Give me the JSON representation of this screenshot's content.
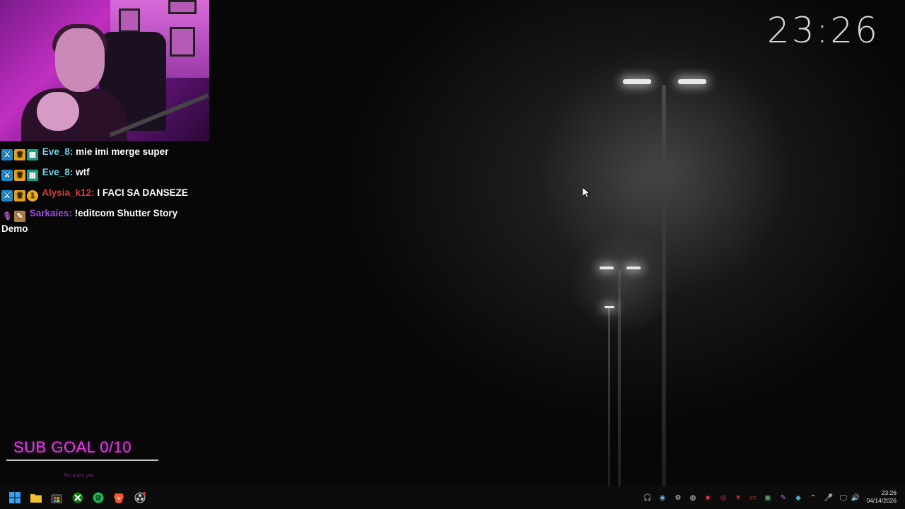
{
  "clock": "23:26",
  "chat": {
    "messages": [
      {
        "user": "Eve_8",
        "user_color": "#70d6e8",
        "badges": [
          "mod",
          "crown",
          "sub"
        ],
        "text": "mie imi merge super"
      },
      {
        "user": "Eve_8",
        "user_color": "#70d6e8",
        "badges": [
          "mod",
          "crown",
          "sub"
        ],
        "text": "wtf"
      },
      {
        "user": "Alysia_k12",
        "user_color": "#e03838",
        "badges": [
          "mod",
          "crown",
          "coin"
        ],
        "text": "I FACI SA DANSEZE"
      },
      {
        "user": "Sarkaies",
        "user_color": "#a050e0",
        "badges": [
          "mic",
          "art"
        ],
        "text": "!editcom Shutter Story Demo"
      }
    ]
  },
  "sub_goal": {
    "label": "SUB GOAL 0/10",
    "subtext": "No subs yet"
  },
  "taskbar": {
    "apps": [
      {
        "name": "start",
        "icon": "windows-icon"
      },
      {
        "name": "explorer",
        "icon": "folder-icon"
      },
      {
        "name": "store",
        "icon": "store-icon"
      },
      {
        "name": "xbox",
        "icon": "xbox-icon"
      },
      {
        "name": "spotify",
        "icon": "spotify-icon"
      },
      {
        "name": "brave",
        "icon": "brave-icon"
      },
      {
        "name": "obs",
        "icon": "obs-icon"
      }
    ],
    "tray_time": "23:26",
    "tray_date": "04/14/2026"
  }
}
